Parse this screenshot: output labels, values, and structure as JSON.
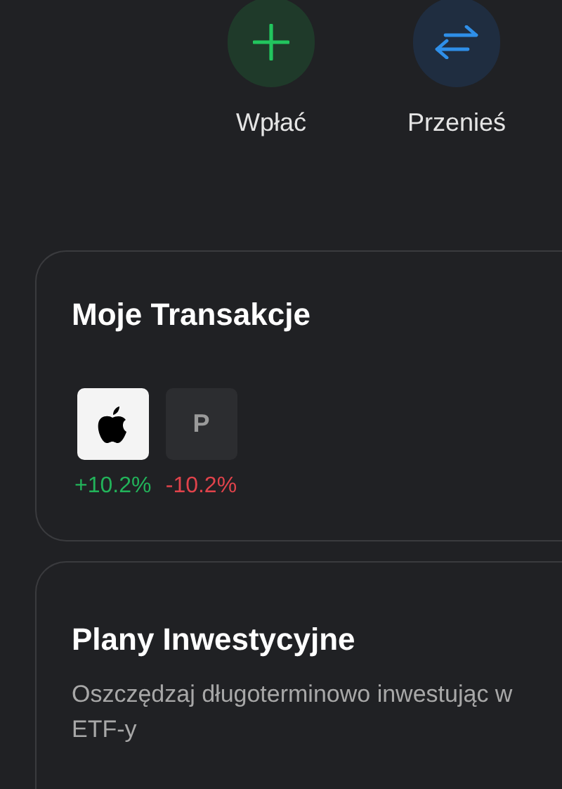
{
  "actions": [
    {
      "kind": "add",
      "label": "Wpłać"
    },
    {
      "kind": "transfer",
      "label": "Przenieś"
    }
  ],
  "transactions": {
    "title": "Moje Transakcje",
    "items": [
      {
        "kind": "logo",
        "change": "+10.2%",
        "color": "#22b35a"
      },
      {
        "kind": "letter",
        "letter": "P",
        "change": "-10.2%",
        "color": "#e0434b"
      }
    ]
  },
  "plans": {
    "title": "Plany Inwestycyjne",
    "description": "Oszczędzaj długoterminowo inwestując w ETF-y"
  }
}
